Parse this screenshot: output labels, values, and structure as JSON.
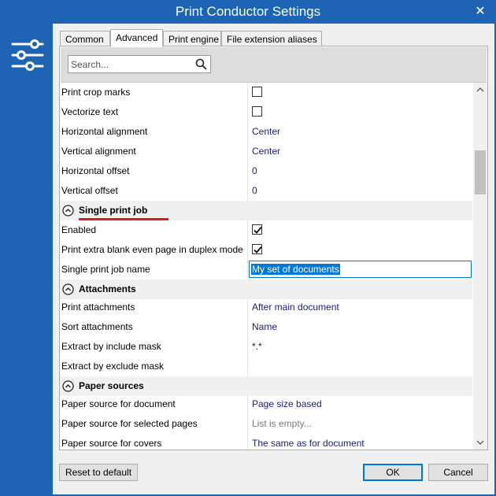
{
  "window": {
    "title": "Print Conductor Settings"
  },
  "tabs": [
    "Common",
    "Advanced",
    "Print engine",
    "File extension aliases"
  ],
  "search": {
    "placeholder": "Search..."
  },
  "rows": {
    "crop_marks": {
      "label": "Print crop marks",
      "checked": false
    },
    "vectorize": {
      "label": "Vectorize text",
      "checked": false
    },
    "h_align": {
      "label": "Horizontal alignment",
      "value": "Center"
    },
    "v_align": {
      "label": "Vertical alignment",
      "value": "Center"
    },
    "h_offset": {
      "label": "Horizontal offset",
      "value": "0"
    },
    "v_offset": {
      "label": "Vertical offset",
      "value": "0"
    },
    "single_job_cat": {
      "label": "Single print job"
    },
    "enabled": {
      "label": "Enabled",
      "checked": true
    },
    "extra_blank": {
      "label": "Print extra blank even page in duplex mode",
      "checked": true
    },
    "job_name": {
      "label": "Single print job name",
      "value": "My set of documents"
    },
    "attachments_cat": {
      "label": "Attachments"
    },
    "print_attach": {
      "label": "Print attachments",
      "value": "After main document"
    },
    "sort_attach": {
      "label": "Sort attachments",
      "value": "Name"
    },
    "include_mask": {
      "label": "Extract by include mask",
      "value": "*.*"
    },
    "exclude_mask": {
      "label": "Extract by exclude mask",
      "value": ""
    },
    "paper_cat": {
      "label": "Paper sources"
    },
    "paper_doc": {
      "label": "Paper source for document",
      "value": "Page size based"
    },
    "paper_sel": {
      "label": "Paper source for selected pages",
      "value": "List is empty..."
    },
    "paper_cov": {
      "label": "Paper source for covers",
      "value": "The same as for document"
    }
  },
  "buttons": {
    "reset": "Reset to default",
    "ok": "OK",
    "cancel": "Cancel"
  },
  "colors": {
    "accent": "#1e64b4",
    "highlight_underline": "#d42020",
    "value_text": "#1a1a80"
  },
  "icons": {
    "app": "settings-sliders-icon",
    "search": "search-icon",
    "close": "close-icon",
    "collapse": "chevron-up-circle-icon"
  }
}
